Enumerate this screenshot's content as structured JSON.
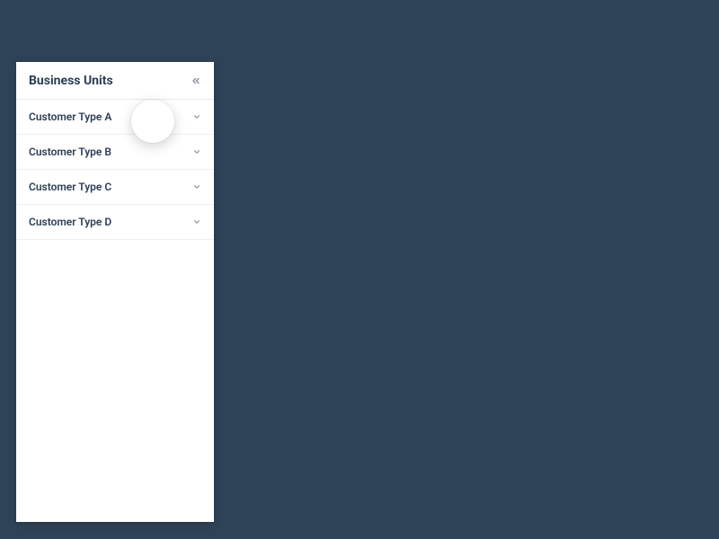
{
  "sidebar": {
    "title": "Business Units",
    "items": [
      {
        "label": "Customer Type A"
      },
      {
        "label": "Customer Type B"
      },
      {
        "label": "Customer Type C"
      },
      {
        "label": "Customer Type D"
      }
    ]
  }
}
